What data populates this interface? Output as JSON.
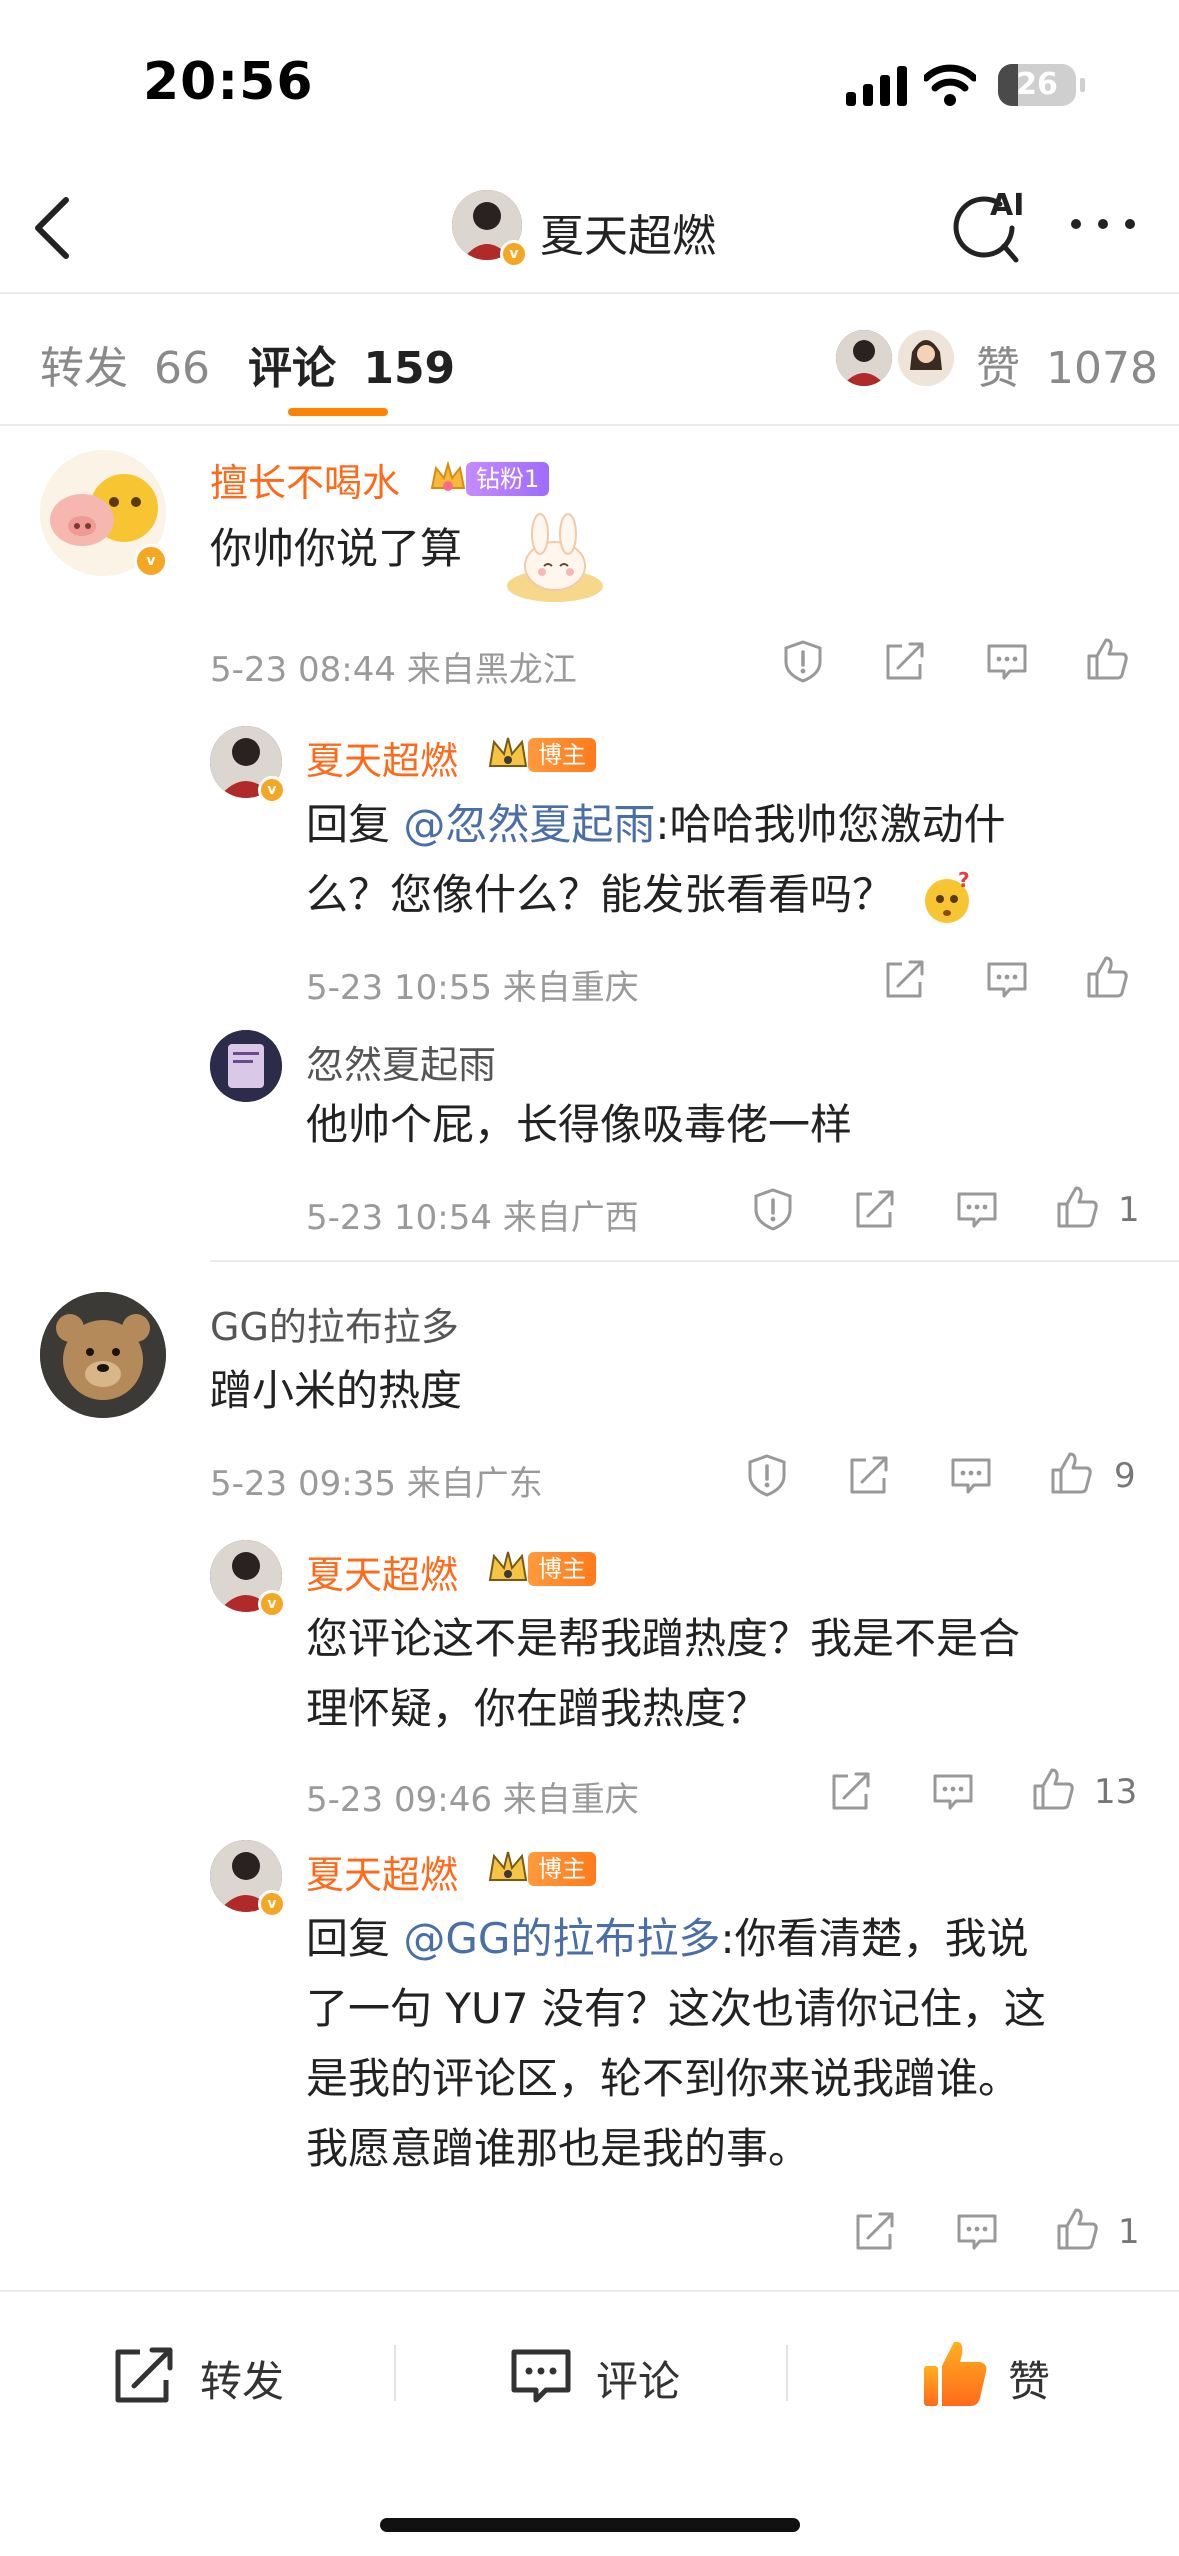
{
  "status_bar": {
    "time": "20:56",
    "battery_percent": "26",
    "battery_level": 0.26
  },
  "header": {
    "title": "夏天超燃",
    "ai_label": "AI"
  },
  "tabs": {
    "repost_label": "转发",
    "repost_count": "66",
    "comment_label": "评论",
    "comment_count": "159",
    "like_label": "赞",
    "like_count": "1078"
  },
  "comments": [
    {
      "name": "擅长不喝水",
      "badge": "钻粉1",
      "text": "你帅你说了算",
      "meta": "5-23 08:44 来自黑龙江",
      "replies": [
        {
          "name": "夏天超燃",
          "badge": "博主",
          "reply_prefix": "回复 ",
          "mention": "@忽然夏起雨",
          "text_line1": ":哈哈我帅您激动什",
          "text_line2": "么？您像什么？能发张看看吗？",
          "meta": "5-23 10:55 来自重庆"
        },
        {
          "name": "忽然夏起雨",
          "text": "他帅个屁，长得像吸毒佬一样",
          "meta": "5-23 10:54 来自广西",
          "likes": "1"
        }
      ]
    },
    {
      "name": "GG的拉布拉多",
      "text": "蹭小米的热度",
      "meta": "5-23 09:35 来自广东",
      "likes": "9",
      "replies": [
        {
          "name": "夏天超燃",
          "badge": "博主",
          "text_line1": "您评论这不是帮我蹭热度？我是不是合",
          "text_line2": "理怀疑，你在蹭我热度？",
          "meta": "5-23 09:46 来自重庆",
          "likes": "13"
        },
        {
          "name": "夏天超燃",
          "badge": "博主",
          "reply_prefix": "回复 ",
          "mention": "@GG的拉布拉多",
          "text_line1": ":你看清楚，我说",
          "text_line2": "了一句 YU7 没有？这次也请你记住，这",
          "text_line3": "是我的评论区，轮不到你来说我蹭谁。",
          "text_line4": "我愿意蹭谁那也是我的事。",
          "likes": "1"
        }
      ]
    }
  ],
  "bottom_bar": {
    "repost": "转发",
    "comment": "评论",
    "like": "赞"
  },
  "colors": {
    "accent": "#ff8200",
    "name_orange": "#ff6a1a",
    "mention_blue": "#4a6ea8"
  }
}
